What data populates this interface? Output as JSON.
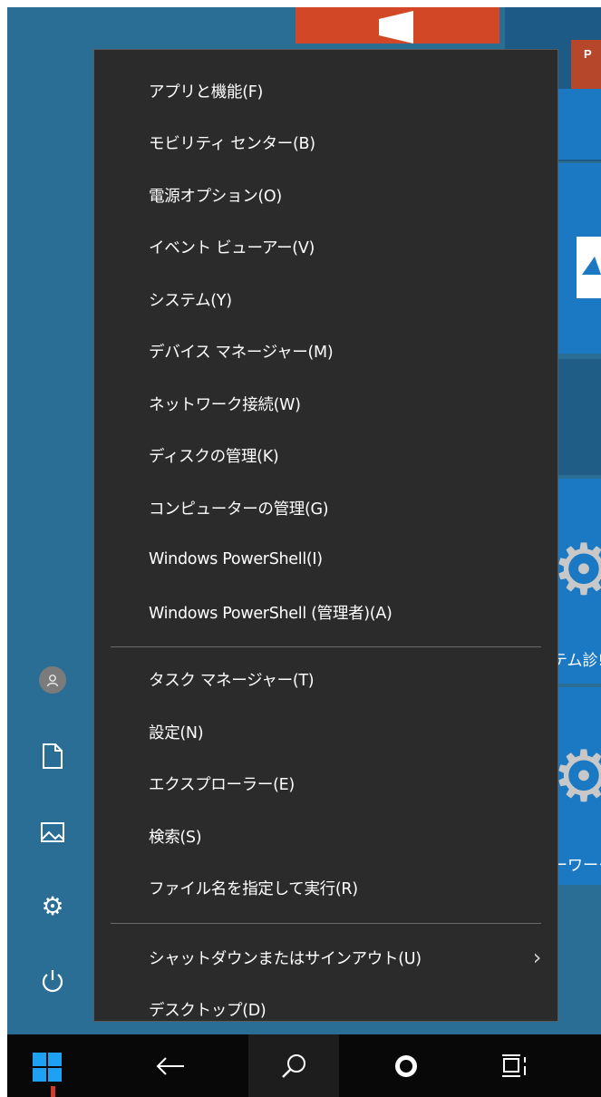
{
  "background_tiles": {
    "ppt_chip_label": "P",
    "partial_labels": [
      {
        "text": "テム診!"
      },
      {
        "text": "ーワーク"
      }
    ]
  },
  "left_rail": {
    "items": [
      {
        "name": "user-avatar",
        "icon": "person-icon"
      },
      {
        "name": "documents",
        "icon": "document-icon"
      },
      {
        "name": "pictures",
        "icon": "picture-icon"
      },
      {
        "name": "settings",
        "icon": "gear-icon"
      },
      {
        "name": "power",
        "icon": "power-icon"
      }
    ]
  },
  "taskbar": {
    "start_icon": "windows-logo-icon",
    "back_icon": "back-arrow-icon",
    "search_icon": "search-icon",
    "cortana_icon": "cortana-circle-icon",
    "task_view_icon": "task-view-icon"
  },
  "context_menu": {
    "groups": [
      {
        "items": [
          {
            "label": "アプリと機能(F)"
          },
          {
            "label": "モビリティ センター(B)"
          },
          {
            "label": "電源オプション(O)"
          },
          {
            "label": "イベント ビューアー(V)"
          },
          {
            "label": "システム(Y)"
          },
          {
            "label": "デバイス マネージャー(M)"
          },
          {
            "label": "ネットワーク接続(W)"
          },
          {
            "label": "ディスクの管理(K)"
          },
          {
            "label": "コンピューターの管理(G)"
          },
          {
            "label": "Windows PowerShell(I)"
          },
          {
            "label": "Windows PowerShell (管理者)(A)"
          }
        ]
      },
      {
        "items": [
          {
            "label": "タスク マネージャー(T)"
          },
          {
            "label": "設定(N)"
          },
          {
            "label": "エクスプローラー(E)"
          },
          {
            "label": "検索(S)"
          },
          {
            "label": "ファイル名を指定して実行(R)"
          }
        ]
      },
      {
        "items": [
          {
            "label": "シャットダウンまたはサインアウト(U)",
            "submenu_arrow": "›"
          },
          {
            "label": "デスクトップ(D)"
          }
        ]
      }
    ]
  },
  "colors": {
    "menu_background": "#2b2b2b",
    "menu_text": "#ffffff",
    "desktop_background": "#2a6e96",
    "tile_blue": "#1b79c4",
    "taskbar": "#080808",
    "start_logo": "#1ea1f2"
  }
}
